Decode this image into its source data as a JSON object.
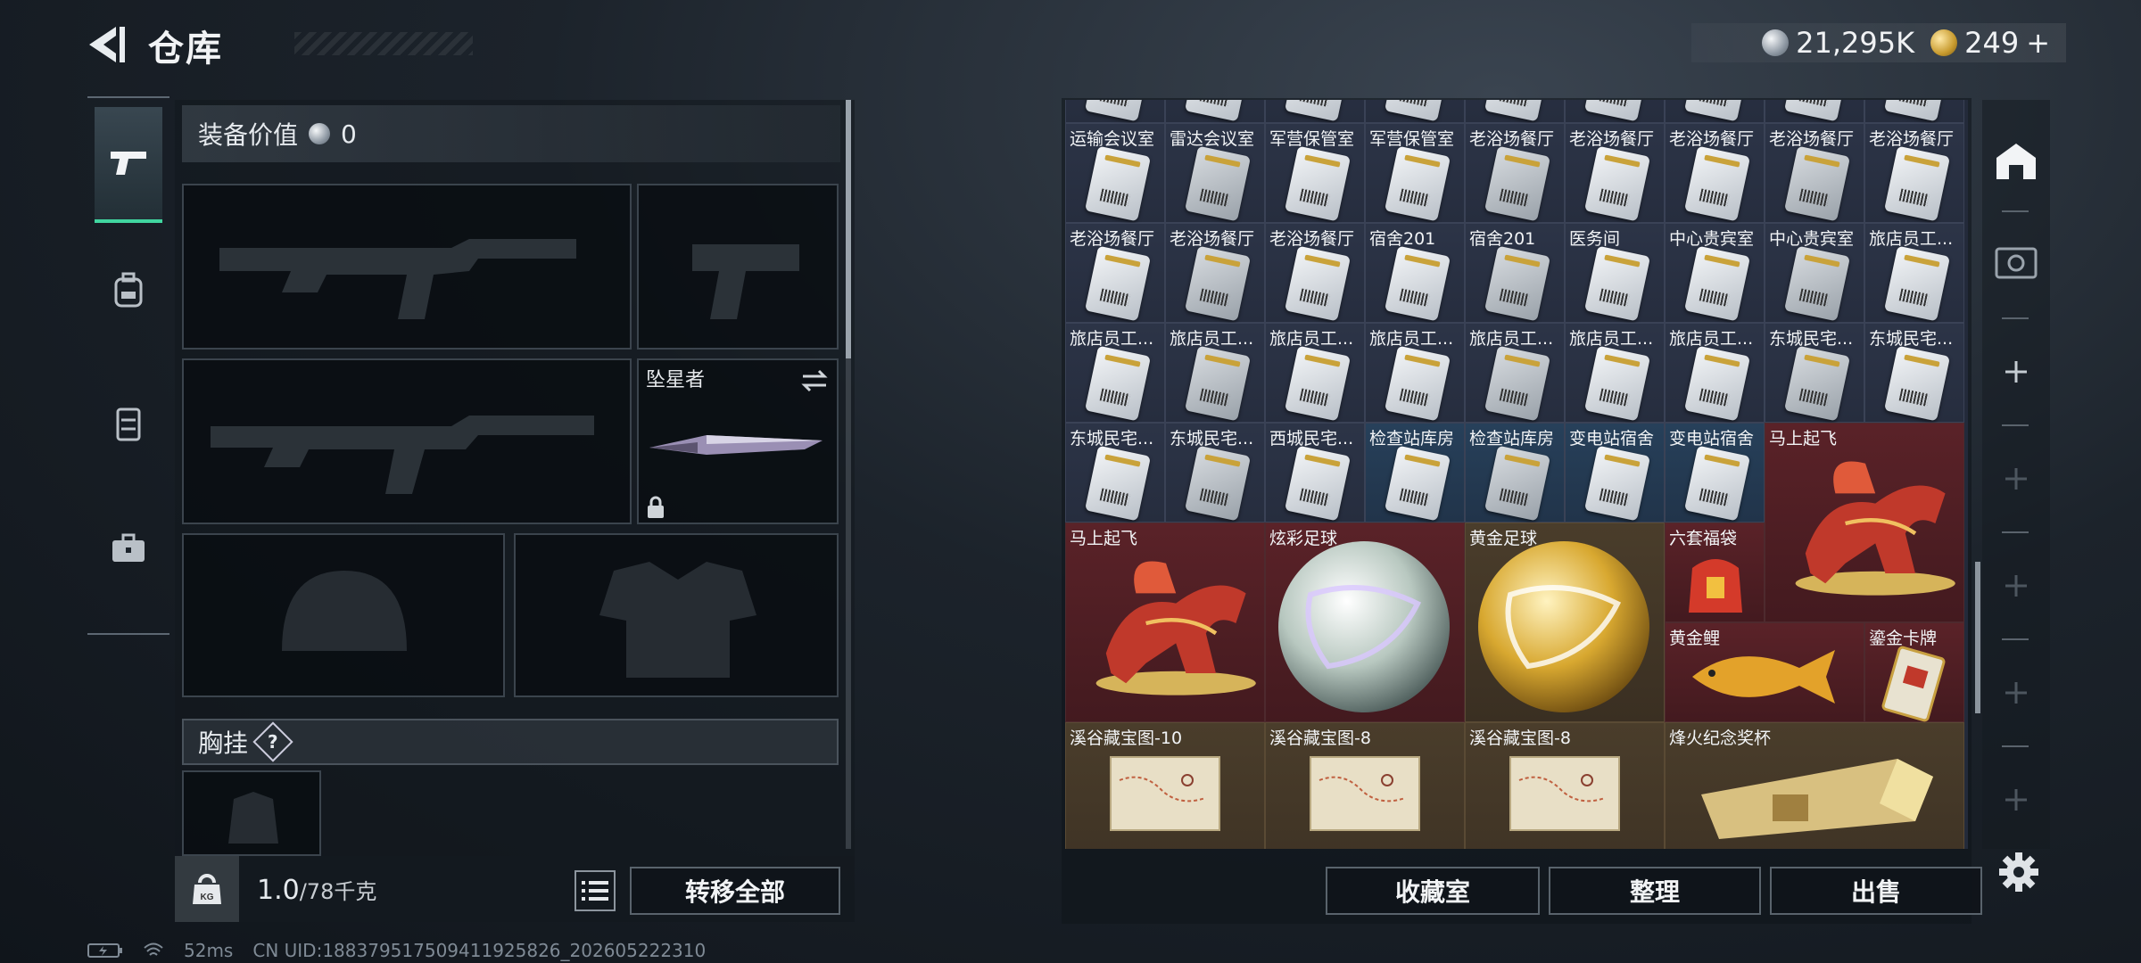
{
  "header": {
    "title": "仓库",
    "currency_silver": "21,295K",
    "currency_gold": "249",
    "gold_plus": "+"
  },
  "equipment": {
    "value_label": "装备价值",
    "value": "0",
    "melee_name": "坠星者",
    "chest_label": "胸挂",
    "help": "?"
  },
  "weight": {
    "current": "1.0",
    "max": "/78千克",
    "icon_text": "KG"
  },
  "buttons": {
    "transfer_all": "转移全部",
    "collection": "收藏室",
    "organize": "整理",
    "sell": "出售"
  },
  "grid": {
    "rows": [
      [
        "运输会议室",
        "雷达会议室",
        "军营保管室",
        "军营保管室",
        "老浴场餐厅",
        "老浴场餐厅",
        "老浴场餐厅",
        "老浴场餐厅",
        "老浴场餐厅"
      ],
      [
        "老浴场餐厅",
        "老浴场餐厅",
        "老浴场餐厅",
        "宿舍201",
        "宿舍201",
        "医务间",
        "中心贵宾室",
        "中心贵宾室",
        "旅店员工..."
      ],
      [
        "旅店员工...",
        "旅店员工...",
        "旅店员工...",
        "旅店员工...",
        "旅店员工...",
        "旅店员工...",
        "旅店员工...",
        "东城民宅...",
        "东城民宅..."
      ],
      [
        "东城民宅...",
        "东城民宅...",
        "西城民宅...",
        "检查站库房",
        "检查站库房",
        "变电站宿舍",
        "变电站宿舍"
      ]
    ],
    "special": {
      "horse1": "马上起飞",
      "horse2": "马上起飞",
      "ball_color": "炫彩足球",
      "ball_gold": "黄金足球",
      "lucky_bag": "六套福袋",
      "goldfish": "黄金鲤",
      "gold_card": "鎏金卡牌",
      "map1": "溪谷藏宝图-10",
      "map2": "溪谷藏宝图-8",
      "map3": "溪谷藏宝图-8",
      "trophy": "烽火纪念奖杯"
    }
  },
  "status": {
    "ping": "52ms",
    "uid": "CN UID:18837951750941192582­6_202605222310"
  },
  "colors": {
    "accent": "#41d6a0",
    "special_red": "#5a2228",
    "special_brown": "#4a3d2b"
  }
}
